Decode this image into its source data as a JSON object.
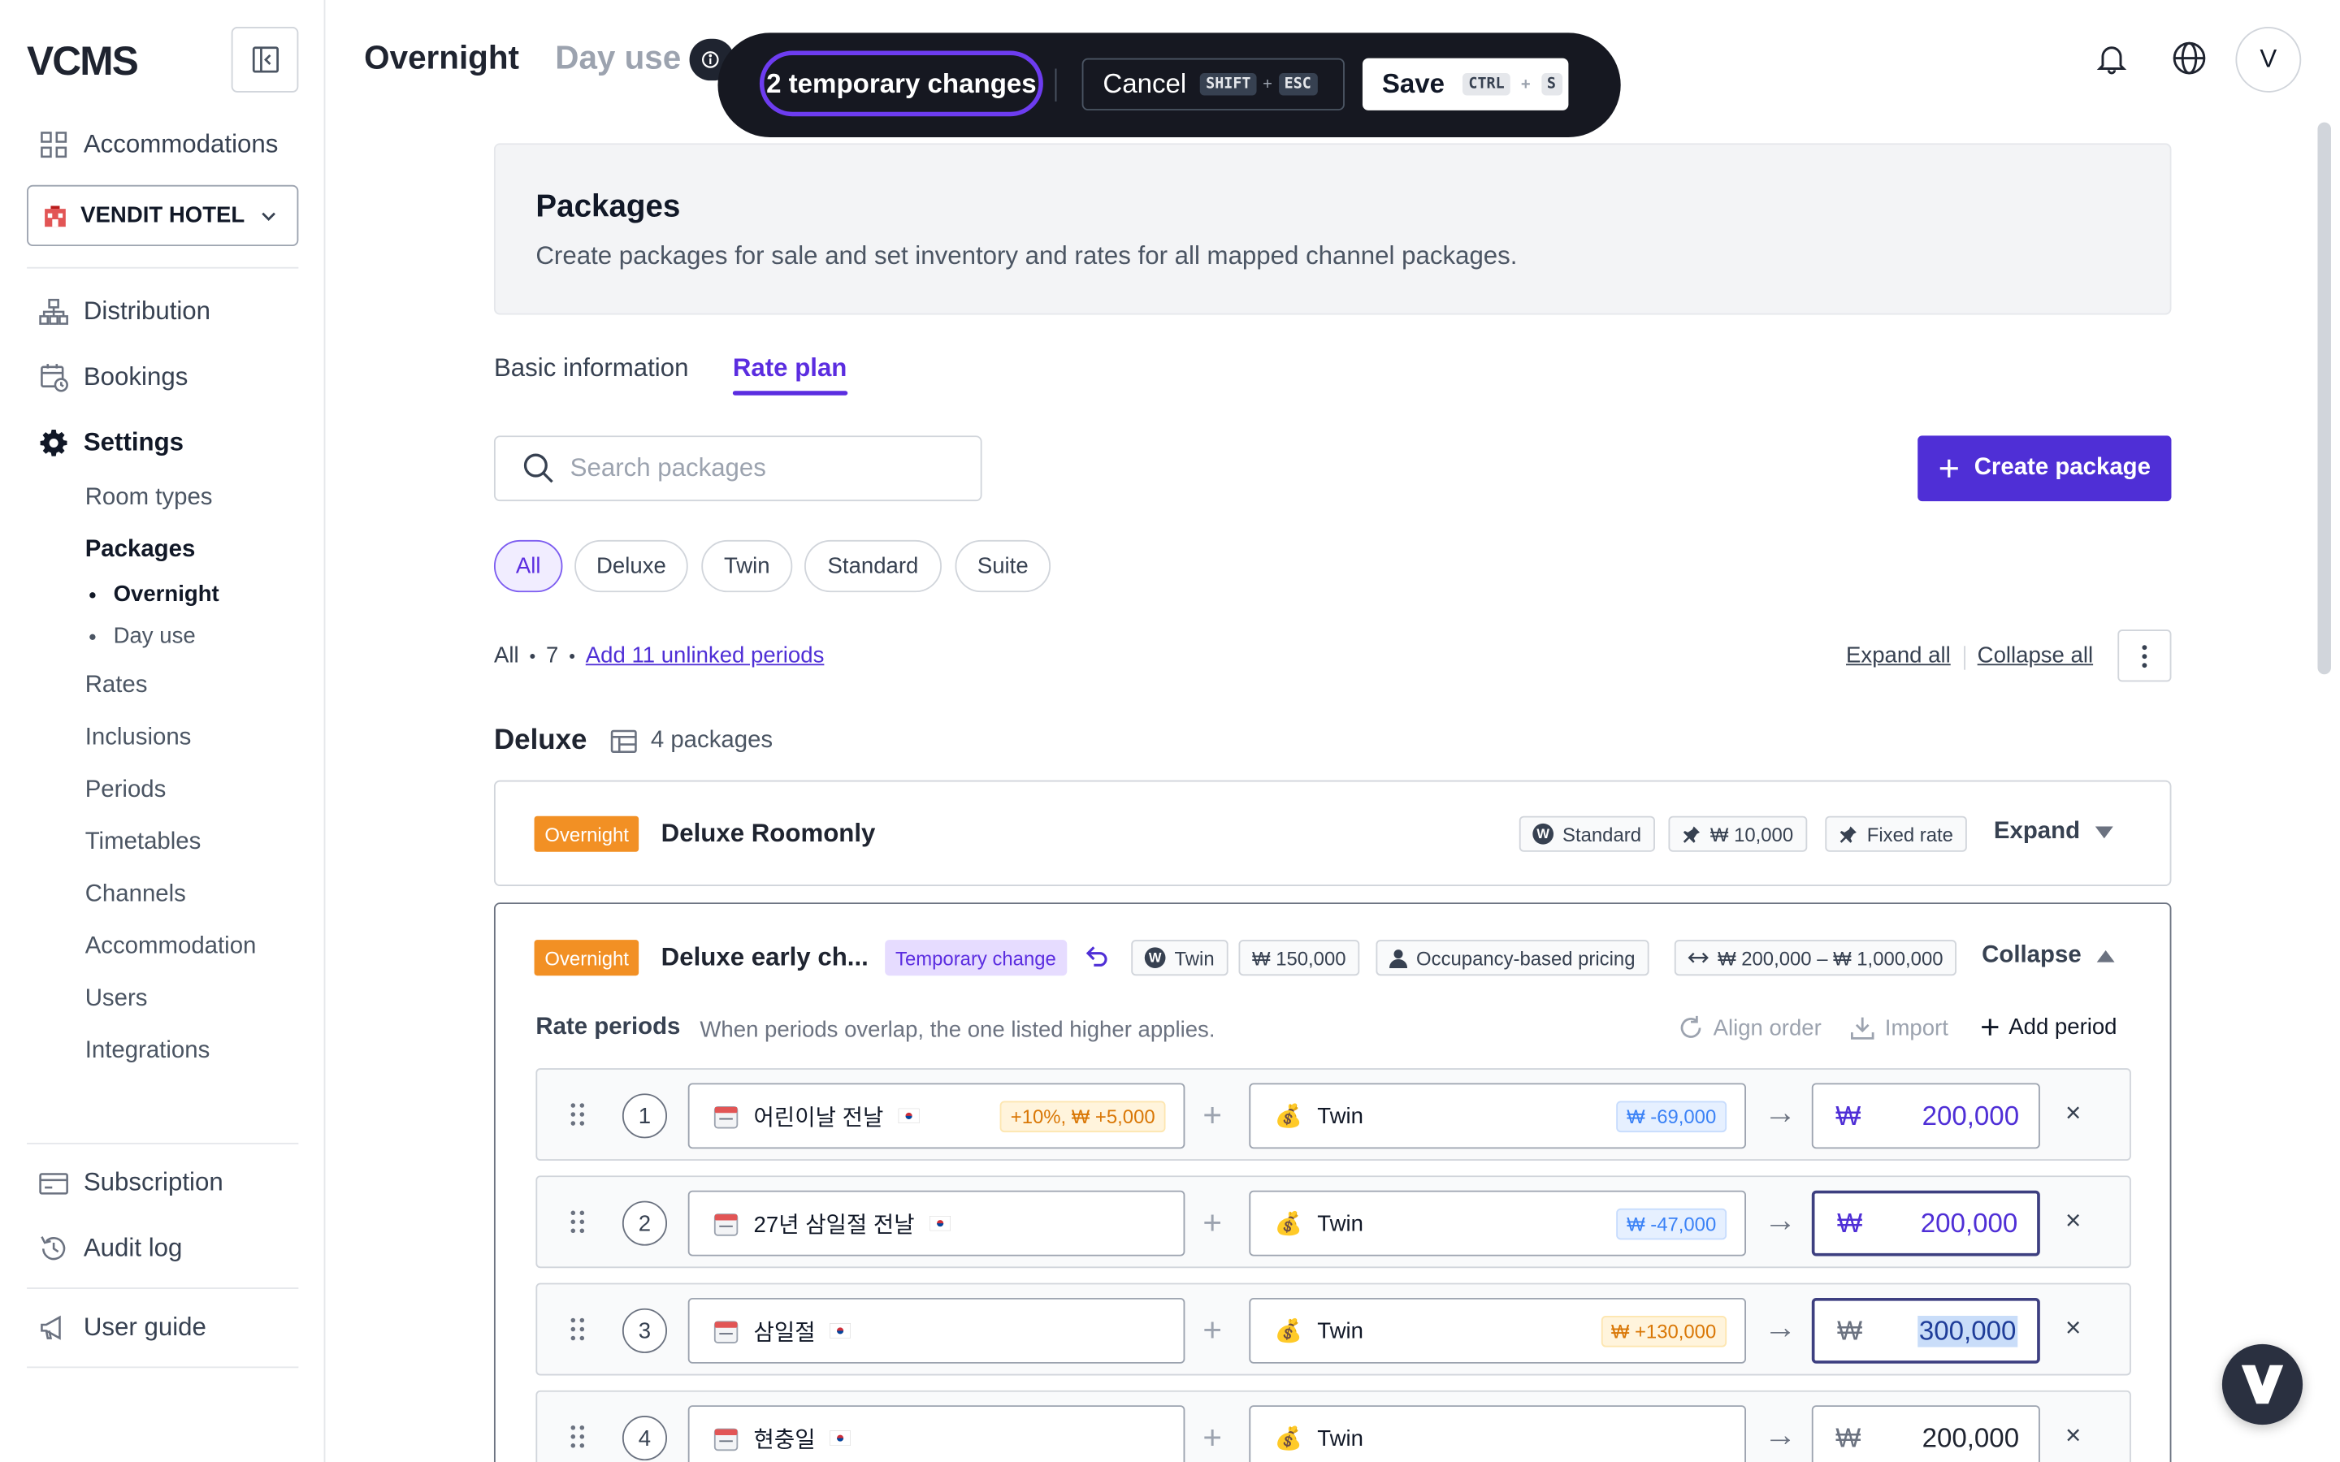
{
  "sidebar": {
    "logo": "VCMS",
    "accommodations_label": "Accommodations",
    "hotel_name": "VENDIT HOTEL",
    "distribution_label": "Distribution",
    "bookings_label": "Bookings",
    "settings_label": "Settings",
    "settings_items": [
      "Room types",
      "Packages",
      "Rates",
      "Inclusions",
      "Periods",
      "Timetables",
      "Channels",
      "Accommodation",
      "Users",
      "Integrations"
    ],
    "packages_sub": [
      "Overnight",
      "Day use"
    ],
    "subscription_label": "Subscription",
    "audit_label": "Audit log",
    "guide_label": "User guide"
  },
  "header": {
    "tab_overnight": "Overnight",
    "tab_dayuse": "Day use",
    "avatar_initial": "V"
  },
  "changes_bar": {
    "label": "2 temporary changes",
    "cancel_label": "Cancel",
    "cancel_keys": [
      "SHIFT",
      "ESC"
    ],
    "save_label": "Save",
    "save_keys": [
      "CTRL",
      "S"
    ],
    "plus": "+"
  },
  "panel": {
    "title": "Packages",
    "description": "Create packages for sale and set inventory and rates for all mapped channel packages."
  },
  "tabs": {
    "basic": "Basic information",
    "rate": "Rate plan"
  },
  "search": {
    "placeholder": "Search packages"
  },
  "create_button": "Create package",
  "filters": [
    "All",
    "Deluxe",
    "Twin",
    "Standard",
    "Suite"
  ],
  "summary": {
    "all": "All",
    "sep": "•",
    "count": "7",
    "unlinked": "Add 11 unlinked periods",
    "expand_all": "Expand all",
    "collapse_all": "Collapse all"
  },
  "group": {
    "title": "Deluxe",
    "count": "4 packages"
  },
  "card1": {
    "badge": "Overnight",
    "name": "Deluxe Roomonly",
    "tags": [
      "Standard",
      "₩ 10,000",
      "Fixed rate"
    ],
    "toggle": "Expand"
  },
  "card2": {
    "badge": "Overnight",
    "name": "Deluxe early ch...",
    "temp_tag": "Temporary change",
    "tags": [
      "Twin",
      "₩ 150,000",
      "Occupancy-based pricing",
      "₩ 200,000 – ₩ 1,000,000"
    ],
    "toggle": "Collapse",
    "rp_title": "Rate periods",
    "rp_hint": "When periods overlap, the one listed higher applies.",
    "align_label": "Align order",
    "import_label": "Import",
    "add_period_label": "Add period",
    "rows": [
      {
        "num": "1",
        "period": "어린이날 전날",
        "adj": "+10%, ₩ +5,000",
        "room": "Twin",
        "room_adj": "₩ -69,000",
        "currency": "₩",
        "price": "200,000"
      },
      {
        "num": "2",
        "period": "27년 삼일절 전날",
        "adj": "",
        "room": "Twin",
        "room_adj": "₩ -47,000",
        "currency": "₩",
        "price": "200,000"
      },
      {
        "num": "3",
        "period": "삼일절",
        "adj": "",
        "room": "Twin",
        "room_adj": "₩ +130,000",
        "currency": "₩",
        "price": "300,000"
      },
      {
        "num": "4",
        "period": "현충일",
        "adj": "",
        "room": "Twin",
        "room_adj": "",
        "currency": "₩",
        "price": "200,000"
      }
    ],
    "plus": "+",
    "arrow": "→",
    "remove": "×"
  },
  "colors": {
    "accent": "#4f2fd6",
    "overnight_badge": "#f29024",
    "changes_bar_bg": "#161821"
  }
}
